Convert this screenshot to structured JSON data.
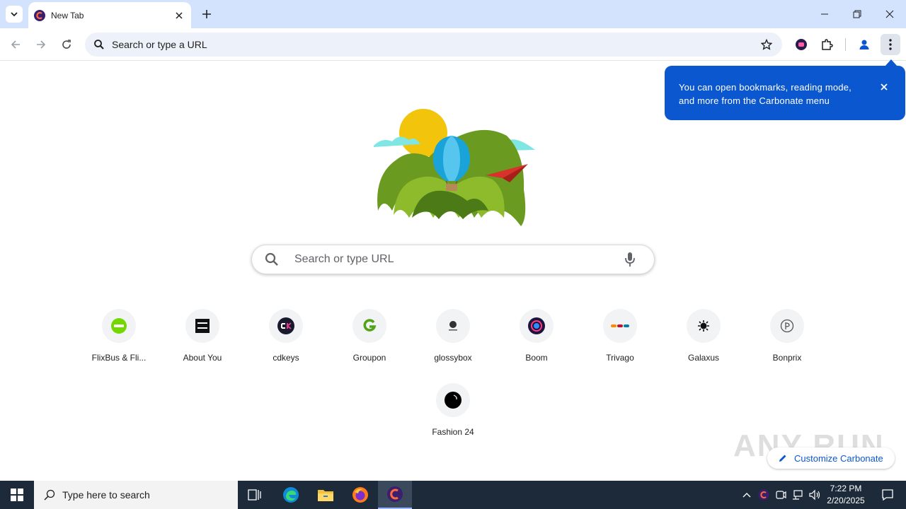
{
  "browser": {
    "tab_title": "New Tab",
    "omnibox_placeholder": "Search or type a URL"
  },
  "callout": {
    "text": "You can open bookmarks, reading mode, and more from the Carbonate menu"
  },
  "ntp": {
    "search_placeholder": "Search or type URL",
    "shortcuts": [
      {
        "label": "FlixBus & Fli..."
      },
      {
        "label": "About You"
      },
      {
        "label": "cdkeys"
      },
      {
        "label": "Groupon"
      },
      {
        "label": "glossybox"
      },
      {
        "label": "Boom"
      },
      {
        "label": "Trivago"
      },
      {
        "label": "Galaxus"
      },
      {
        "label": "Bonprix"
      },
      {
        "label": "Fashion 24"
      }
    ],
    "customize_label": "Customize Carbonate",
    "watermark": "ANY RUN"
  },
  "taskbar": {
    "search_placeholder": "Type here to search",
    "time": "7:22 PM",
    "date": "2/20/2025"
  },
  "colors": {
    "tabstrip": "#d3e3fd",
    "accent": "#0b57d0",
    "taskbar": "#1c2a3a"
  }
}
